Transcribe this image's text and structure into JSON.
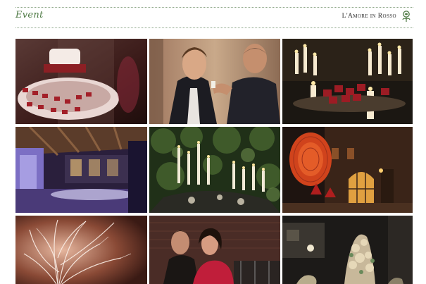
{
  "header": {
    "section_title": "Event",
    "brand_text": "L'Amore in Rosso",
    "brand_mark_icon": "rose-emblem-icon",
    "accent_color": "#4f7a45"
  },
  "gallery": {
    "rows": 3,
    "columns": 3,
    "photos": [
      {
        "name": "photo-wedding-cake-table"
      },
      {
        "name": "photo-groom-boutonniere"
      },
      {
        "name": "photo-candles-red-favors"
      },
      {
        "name": "photo-illuminated-hall"
      },
      {
        "name": "photo-candelabra-greenery"
      },
      {
        "name": "photo-castle-courtyard-night"
      },
      {
        "name": "photo-white-branches-installation"
      },
      {
        "name": "photo-couple-portrait"
      },
      {
        "name": "photo-floral-sculpture-night"
      }
    ]
  }
}
